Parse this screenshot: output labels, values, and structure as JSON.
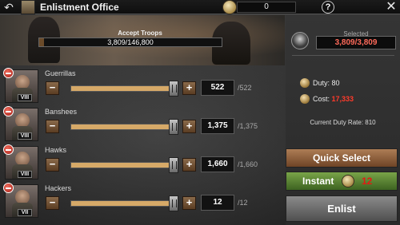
{
  "header": {
    "back_icon": "back-arrow-icon",
    "title": "Enlistment Office",
    "title_icon": "building-icon",
    "coin_value": "0",
    "help_label": "?",
    "close_icon": "close-icon"
  },
  "banner": {
    "label": "Accept Troops",
    "troops_text": "3,809/146,800",
    "troops_fraction": 0.026
  },
  "units": [
    {
      "name": "Guerrillas",
      "tier": "VIII",
      "count": "522",
      "max": "/522",
      "fill": 1.0
    },
    {
      "name": "Banshees",
      "tier": "VIII",
      "count": "1,375",
      "max": "/1,375",
      "fill": 1.0
    },
    {
      "name": "Hawks",
      "tier": "VIII",
      "count": "1,660",
      "max": "/1,660",
      "fill": 1.0
    },
    {
      "name": "Hackers",
      "tier": "VII",
      "count": "12",
      "max": "/12",
      "fill": 1.0
    }
  ],
  "panel": {
    "selected_label": "Selected",
    "selected_value": "3,809/3,809",
    "duty_label": "Duty: 80",
    "cost_label": "Cost: ",
    "cost_value": "17,333",
    "duty_rate": "Current Duty Rate: 810",
    "quick_select": "Quick Select",
    "instant_label": "Instant",
    "instant_cost": "12",
    "enlist": "Enlist"
  },
  "colors": {
    "slider_fill": "#d6a968",
    "quick_select": "#ad7d55",
    "instant": "#79a448",
    "enlist": "#6f6f6f",
    "red_text": "#ff3a2a"
  }
}
